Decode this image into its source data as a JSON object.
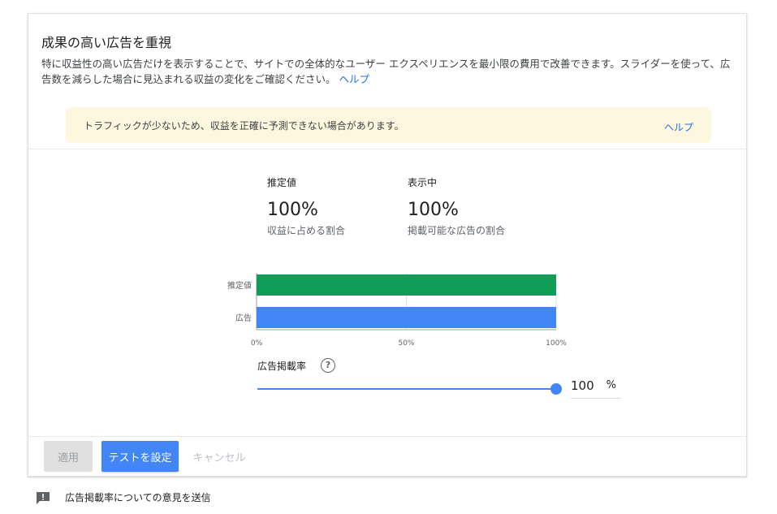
{
  "header": {
    "title": "成果の高い広告を重視",
    "description": "特に収益性の高い広告だけを表示することで、サイトでの全体的なユーザー エクスペリエンスを最小限の費用で改善できます。スライダーを使って、広告数を減らした場合に見込まれる収益の変化をご確認ください。",
    "help_link": "ヘルプ"
  },
  "warning": {
    "text": "トラフィックが少ないため、収益を正確に予測できない場合があります。",
    "help_link": "ヘルプ"
  },
  "metrics": [
    {
      "label": "推定値",
      "value": "100%",
      "sub": "収益に占める割合"
    },
    {
      "label": "表示中",
      "value": "100%",
      "sub": "掲載可能な広告の割合"
    }
  ],
  "chart_data": {
    "type": "bar",
    "orientation": "horizontal",
    "categories": [
      "推定値",
      "広告"
    ],
    "values": [
      100,
      100
    ],
    "colors": [
      "#0f9d58",
      "#4285f4"
    ],
    "xticks": [
      "0%",
      "50%",
      "100%"
    ],
    "xlim": [
      0,
      100
    ],
    "grid": true
  },
  "slider": {
    "label": "広告掲載率",
    "help_icon": "help-circle-icon",
    "value": "100",
    "unit": "%",
    "level": 1.0
  },
  "buttons": {
    "apply": "適用",
    "test": "テストを設定",
    "cancel": "キャンセル"
  },
  "feedback": {
    "icon": "feedback-icon",
    "text": "広告掲載率についての意見を送信"
  },
  "colors": {
    "accent": "#4285f4",
    "green": "#0f9d58",
    "warning_bg": "#fef7e0",
    "link": "#1a73e8"
  }
}
